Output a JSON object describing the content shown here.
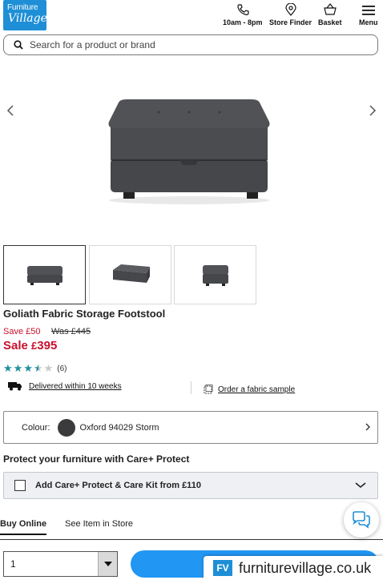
{
  "header": {
    "logo_line1": "Furniture",
    "logo_line2": "Village",
    "hours_label": "10am - 8pm",
    "store_finder_label": "Store Finder",
    "basket_label": "Basket",
    "menu_label": "Menu"
  },
  "search": {
    "placeholder": "Search for a product or brand"
  },
  "product": {
    "title": "Goliath Fabric Storage Footstool",
    "save_text": "Save £50",
    "was_text": "Was £445",
    "sale_label": "Sale",
    "sale_currency": "£",
    "sale_amount": "395",
    "rating": 3.5,
    "rating_max": 5,
    "review_count": "(6)",
    "delivery_text": "Delivered within 10 weeks",
    "sample_text": "Order a fabric sample"
  },
  "colour": {
    "label": "Colour:",
    "value": "Oxford 94029 Storm",
    "swatch_color": "#3b3b3d"
  },
  "care_protect": {
    "heading": "Protect your furniture with Care+ Protect",
    "option_label": "Add Care+ Protect & Care Kit from £110"
  },
  "tabs": [
    {
      "label": "Buy Online",
      "active": true
    },
    {
      "label": "See Item in Store",
      "active": false
    }
  ],
  "quantity": {
    "value": "1"
  },
  "banner": {
    "logo": "FV",
    "url": "furniturevillage.co.uk"
  },
  "colors": {
    "brand_blue": "#1e8fd6",
    "sale_red": "#c8102e",
    "star_teal": "#1f8ea0",
    "button_blue": "#2196f3"
  }
}
